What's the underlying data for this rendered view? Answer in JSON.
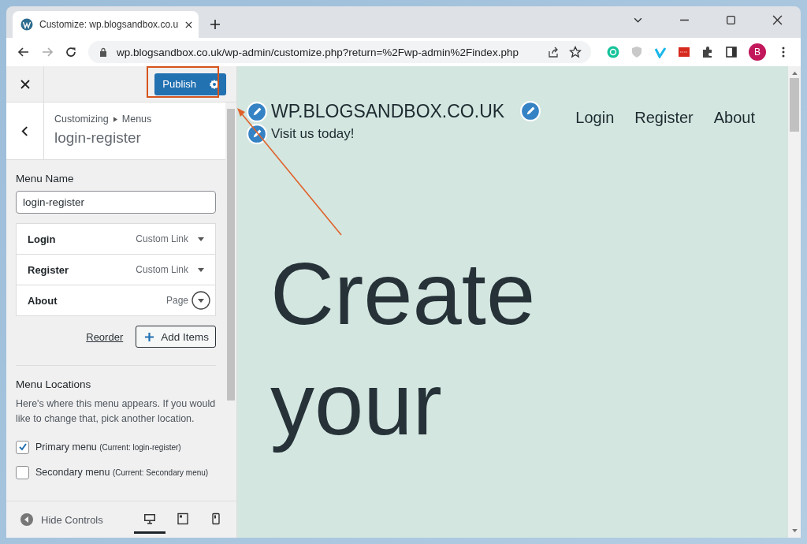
{
  "browser": {
    "tab_title": "Customize: wp.blogsandbox.co.u",
    "url": "wp.blogsandbox.co.uk/wp-admin/customize.php?return=%2Fwp-admin%2Findex.php",
    "profile": "B"
  },
  "sidebar": {
    "publish": "Publish",
    "breadcrumb": [
      "Customizing",
      "Menus"
    ],
    "title": "login-register",
    "menu_name_label": "Menu Name",
    "menu_name_value": "login-register",
    "items": [
      {
        "title": "Login",
        "type": "Custom Link",
        "selected": false
      },
      {
        "title": "Register",
        "type": "Custom Link",
        "selected": false
      },
      {
        "title": "About",
        "type": "Page",
        "selected": true
      }
    ],
    "reorder": "Reorder",
    "add_items": "Add Items",
    "locations_heading": "Menu Locations",
    "locations_text": "Here's where this menu appears. If you would like to change that, pick another location.",
    "locations": [
      {
        "label": "Primary menu",
        "current": "(Current: login-register)",
        "checked": true
      },
      {
        "label": "Secondary menu",
        "current": "(Current: Secondary menu)",
        "checked": false
      }
    ],
    "hide_controls": "Hide Controls",
    "devices": [
      {
        "kind": "desktop",
        "selected": true
      },
      {
        "kind": "tablet",
        "selected": false
      },
      {
        "kind": "mobile",
        "selected": false
      }
    ]
  },
  "preview": {
    "site_title": "WP.BLOGSANDBOX.CO.UK",
    "tagline": "Visit us today!",
    "nav": [
      "Login",
      "Register",
      "About"
    ],
    "hero": [
      "Create",
      "your"
    ]
  }
}
